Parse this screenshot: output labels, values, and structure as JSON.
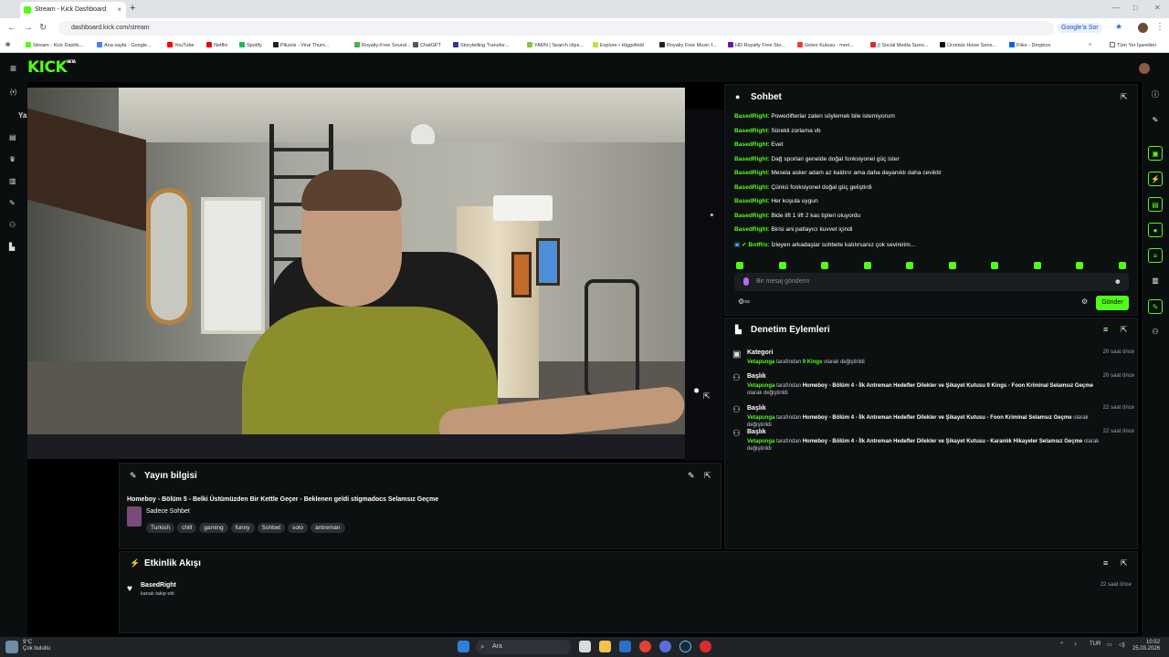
{
  "browser": {
    "tab_title": "Stream - Kick Dashboard",
    "new_tab": "+",
    "url": "dashboard.kick.com/stream",
    "google_sor": "Google'a Sor",
    "win_min": "—",
    "win_max": "□",
    "win_close": "✕",
    "bookmarks": [
      {
        "label": "Stream - Kick Dashb...",
        "color": "#53fc18"
      },
      {
        "label": "Ana sayfa - Google...",
        "color": "#4285f4"
      },
      {
        "label": "YouTube",
        "color": "#ff0000"
      },
      {
        "label": "Netflix",
        "color": "#e50914"
      },
      {
        "label": "Spotify",
        "color": "#1db954"
      },
      {
        "label": "Pikzels - Viral Thum...",
        "color": "#222222"
      },
      {
        "label": "Royalty-Free Sound...",
        "color": "#4caf50"
      },
      {
        "label": "ChatGPT",
        "color": "#555555"
      },
      {
        "label": "Storytelling Transfor...",
        "color": "#333399"
      },
      {
        "label": "YARN | Search clips...",
        "color": "#8bc34a"
      },
      {
        "label": "Explore • Higgsfield",
        "color": "#c6e13a"
      },
      {
        "label": "Royalty Free Music f...",
        "color": "#222222"
      },
      {
        "label": "HD Royalty Free Sto...",
        "color": "#6a1b9a"
      },
      {
        "label": "Gelen Kutusu - mert...",
        "color": "#ea4335"
      },
      {
        "label": "|| Social Media Sizes...",
        "color": "#d32f2f"
      },
      {
        "label": "Ücretsiz Hisse Sene...",
        "color": "#111111"
      },
      {
        "label": "Files - Dropbox",
        "color": "#0061ff"
      }
    ],
    "bookmarks_more": "»",
    "all_bookmarks": "Tüm Yer İşaretleri"
  },
  "kick": {
    "logo": "KICK",
    "logo_badge": "BETA",
    "leftnav_partial": "Ya"
  },
  "chat": {
    "title": "Sohbet",
    "messages": [
      {
        "user": "BasedRight",
        "text": "Powerlifterlar zaten söylemek bile istemiyorum"
      },
      {
        "user": "BasedRight",
        "text": "Sürekli zorlama vb"
      },
      {
        "user": "BasedRight",
        "text": "Evet"
      },
      {
        "user": "BasedRight",
        "text": "Dağ sporlari genelde doğal fonksiyonel güç ister"
      },
      {
        "user": "BasedRight",
        "text": "Mesela asker adam az kaldırır ama daha dayanıklı daha ceviktir"
      },
      {
        "user": "BasedRight",
        "text": "Çünkü fonksiyonel doğal güç geliştirdi"
      },
      {
        "user": "BasedRight",
        "text": "Her koşula uygun"
      },
      {
        "user": "BasedRight",
        "text": "Bide lift 1 lift 2 kas tipleri oluyordu"
      },
      {
        "user": "BasedRight",
        "text": "Birisi ani patlayıcı kuvvet içindi"
      },
      {
        "user": "BotRix",
        "text": "İzleyen arkadaşlar sohbete katılırsanız çok sevinirim..."
      }
    ],
    "input_placeholder": "Bir mesaj gönderin",
    "send_label": "Gönder"
  },
  "moderation": {
    "title": "Denetim Eylemleri",
    "items": [
      {
        "kind": "Kategori",
        "time": "20 saat önce",
        "actor": "Vetapunga",
        "mid": "tarafından",
        "value": "9 Kings",
        "tail": "olarak değiştirildi"
      },
      {
        "kind": "Başlık",
        "time": "20 saat önce",
        "actor": "Vetapunga",
        "mid": "tarafından",
        "value": "Homeboy - Bölüm 4 - İlk Antreman Hedefler Dilekler ve Şikayet Kutusu 9 Kings - Foon Kriminal Selamsız Geçme",
        "tail": "olarak değiştirildi"
      },
      {
        "kind": "Başlık",
        "time": "22 saat önce",
        "actor": "Vetapunga",
        "mid": "tarafından",
        "value": "Homeboy - Bölüm 4 - İlk Antreman Hedefler Dilekler ve Şikayet Kutusu - Foon Kriminal Selamsız Geçme",
        "tail": "olarak değiştirildi"
      },
      {
        "kind": "Başlık",
        "time": "22 saat önce",
        "actor": "Vetapunga",
        "mid": "tarafından",
        "value": "Homeboy - Bölüm 4 - İlk Antreman Hedefler Dilekler ve Şikayet Kutusu - Karanlık Hikayeler Selamsız Geçme",
        "tail": "olarak değiştirildi"
      }
    ]
  },
  "stream_info": {
    "title": "Yayın bilgisi",
    "stream_title": "Homeboy - Bölüm 5 - Belki Üstümüzden Bir Kettle Geçer - Beklenen geldi stigmadocs Selamsız Geçme",
    "category": "Sadece Sohbet",
    "tags": [
      "Turkish",
      "chill",
      "gaming",
      "funny",
      "Sohbet",
      "solo",
      "antreman"
    ]
  },
  "activity": {
    "title": "Etkinlik Akışı",
    "items": [
      {
        "user": "BasedRight",
        "action": "kanalı takip etti",
        "time": "22 saat önce"
      }
    ]
  },
  "taskbar": {
    "temp": "9°C",
    "weather": "Çok bulutlu",
    "search": "Ara",
    "lang": "TUR",
    "time": "10:52",
    "date": "25.03.2026"
  }
}
